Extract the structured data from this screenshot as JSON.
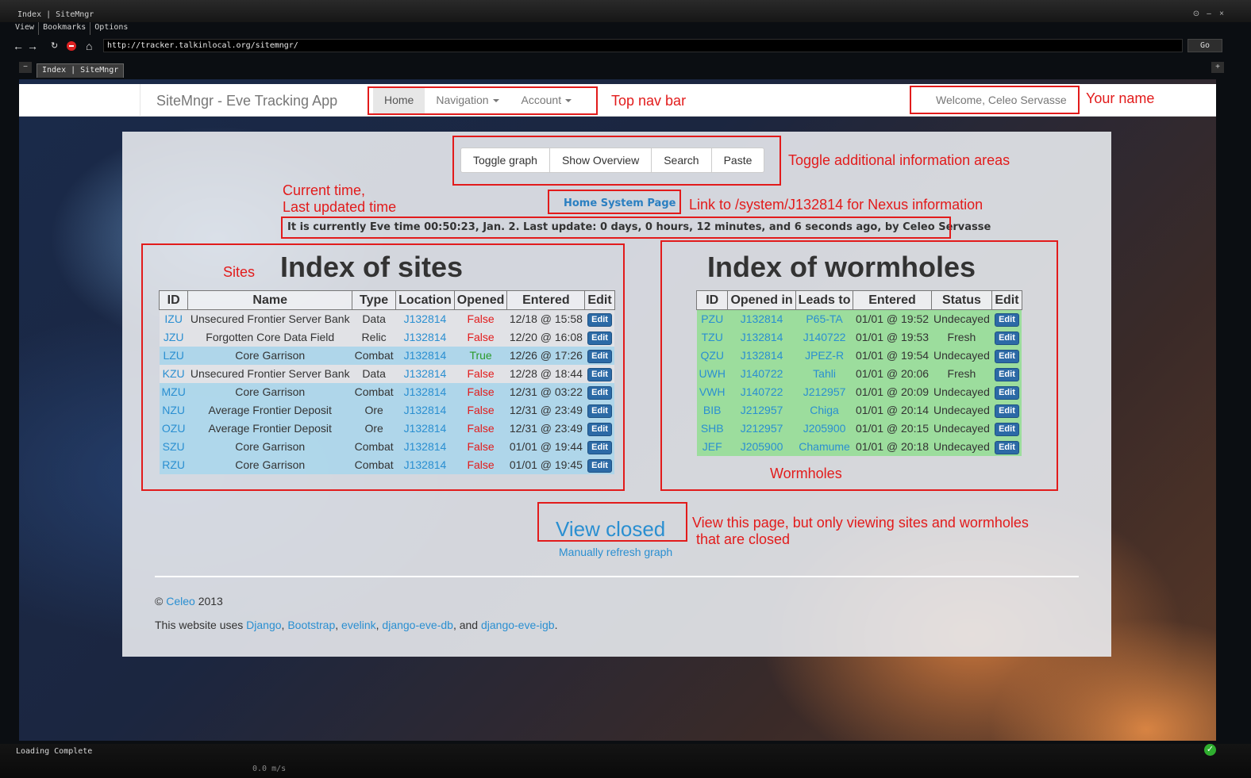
{
  "window": {
    "title": "Index | SiteMngr",
    "controls": [
      "⊙",
      "–",
      "×"
    ]
  },
  "menubar": [
    "View",
    "Bookmarks",
    "Options"
  ],
  "address": {
    "url": "http://tracker.talkinlocal.org/sitemngr/",
    "go_label": "Go"
  },
  "tabs": {
    "minus": "−",
    "active": "Index | SiteMngr",
    "plus": "+"
  },
  "site_nav": {
    "brand": "SiteMngr - Eve Tracking App",
    "links": [
      "Home",
      "Navigation",
      "Account"
    ],
    "welcome": "Welcome, Celeo Servasse"
  },
  "toolbar": {
    "buttons": [
      "Toggle graph",
      "Show Overview",
      "Search",
      "Paste"
    ]
  },
  "home_system_link": "Home System Page",
  "status_line": "It is currently Eve time 00:50:23, Jan. 2. Last update: 0 days, 0 hours, 12 minutes, and 6 seconds ago, by Celeo Servasse",
  "sites": {
    "title": "Index of sites",
    "headers": [
      "ID",
      "Name",
      "Type",
      "Location",
      "Opened",
      "Entered",
      "Edit"
    ],
    "rows": [
      {
        "id": "IZU",
        "name": "Unsecured Frontier Server Bank",
        "type": "Data",
        "location": "J132814",
        "opened": "False",
        "entered": "12/18 @ 15:58",
        "row": "grey"
      },
      {
        "id": "JZU",
        "name": "Forgotten Core Data Field",
        "type": "Relic",
        "location": "J132814",
        "opened": "False",
        "entered": "12/20 @ 16:08",
        "row": "grey"
      },
      {
        "id": "LZU",
        "name": "Core Garrison",
        "type": "Combat",
        "location": "J132814",
        "opened": "True",
        "entered": "12/26 @ 17:26",
        "row": "blue"
      },
      {
        "id": "KZU",
        "name": "Unsecured Frontier Server Bank",
        "type": "Data",
        "location": "J132814",
        "opened": "False",
        "entered": "12/28 @ 18:44",
        "row": "grey"
      },
      {
        "id": "MZU",
        "name": "Core Garrison",
        "type": "Combat",
        "location": "J132814",
        "opened": "False",
        "entered": "12/31 @ 03:22",
        "row": "blue"
      },
      {
        "id": "NZU",
        "name": "Average Frontier Deposit",
        "type": "Ore",
        "location": "J132814",
        "opened": "False",
        "entered": "12/31 @ 23:49",
        "row": "blue"
      },
      {
        "id": "OZU",
        "name": "Average Frontier Deposit",
        "type": "Ore",
        "location": "J132814",
        "opened": "False",
        "entered": "12/31 @ 23:49",
        "row": "blue"
      },
      {
        "id": "SZU",
        "name": "Core Garrison",
        "type": "Combat",
        "location": "J132814",
        "opened": "False",
        "entered": "01/01 @ 19:44",
        "row": "blue"
      },
      {
        "id": "RZU",
        "name": "Core Garrison",
        "type": "Combat",
        "location": "J132814",
        "opened": "False",
        "entered": "01/01 @ 19:45",
        "row": "blue"
      }
    ]
  },
  "wormholes": {
    "title": "Index of wormholes",
    "headers": [
      "ID",
      "Opened in",
      "Leads to",
      "Entered",
      "Status",
      "Edit"
    ],
    "rows": [
      {
        "id": "PZU",
        "opened_in": "J132814",
        "leads_to": "P65-TA",
        "entered": "01/01 @ 19:52",
        "status": "Undecayed"
      },
      {
        "id": "TZU",
        "opened_in": "J132814",
        "leads_to": "J140722",
        "entered": "01/01 @ 19:53",
        "status": "Fresh"
      },
      {
        "id": "QZU",
        "opened_in": "J132814",
        "leads_to": "JPEZ-R",
        "entered": "01/01 @ 19:54",
        "status": "Undecayed"
      },
      {
        "id": "UWH",
        "opened_in": "J140722",
        "leads_to": "Tahli",
        "entered": "01/01 @ 20:06",
        "status": "Fresh"
      },
      {
        "id": "VWH",
        "opened_in": "J140722",
        "leads_to": "J212957",
        "entered": "01/01 @ 20:09",
        "status": "Undecayed"
      },
      {
        "id": "BIB",
        "opened_in": "J212957",
        "leads_to": "Chiga",
        "entered": "01/01 @ 20:14",
        "status": "Undecayed"
      },
      {
        "id": "SHB",
        "opened_in": "J212957",
        "leads_to": "J205900",
        "entered": "01/01 @ 20:15",
        "status": "Undecayed"
      },
      {
        "id": "JEF",
        "opened_in": "J205900",
        "leads_to": "Chamume",
        "entered": "01/01 @ 20:18",
        "status": "Undecayed"
      }
    ]
  },
  "edit_label": "Edit",
  "view_closed": "View closed",
  "refresh_graph": "Manually refresh graph",
  "footer": {
    "copyright": "©",
    "author": "Celeo",
    "year": "2013",
    "uses_prefix": "This website uses",
    "django": "Django",
    "bootstrap": "Bootstrap",
    "evelink": "evelink",
    "django_eve_db": "django-eve-db",
    "and": ", and",
    "django_eve_igb": "django-eve-igb"
  },
  "annotations": {
    "top_nav": "Top nav bar",
    "your_name": "Your name",
    "toggle": "Toggle additional information areas",
    "current_time_1": "Current time,",
    "current_time_2": "Last updated time",
    "nexus_link": "Link to /system/J132814 for Nexus information",
    "sites": "Sites",
    "wormholes": "Wormholes",
    "view_closed_1": "View this page, but only viewing sites and wormholes",
    "view_closed_2": "that are closed"
  },
  "statusbar": {
    "text": "Loading Complete",
    "speed": "0.0 m/s"
  },
  "colors": {
    "annotation": "#e21b1b",
    "link": "#2a8fd1",
    "false_text": "#e21b1b",
    "true_text": "#2a9a2a",
    "edit_button": "#2c6aa6",
    "site_row_blue": "#aad6ec",
    "wormhole_row_green": "#96de96"
  }
}
